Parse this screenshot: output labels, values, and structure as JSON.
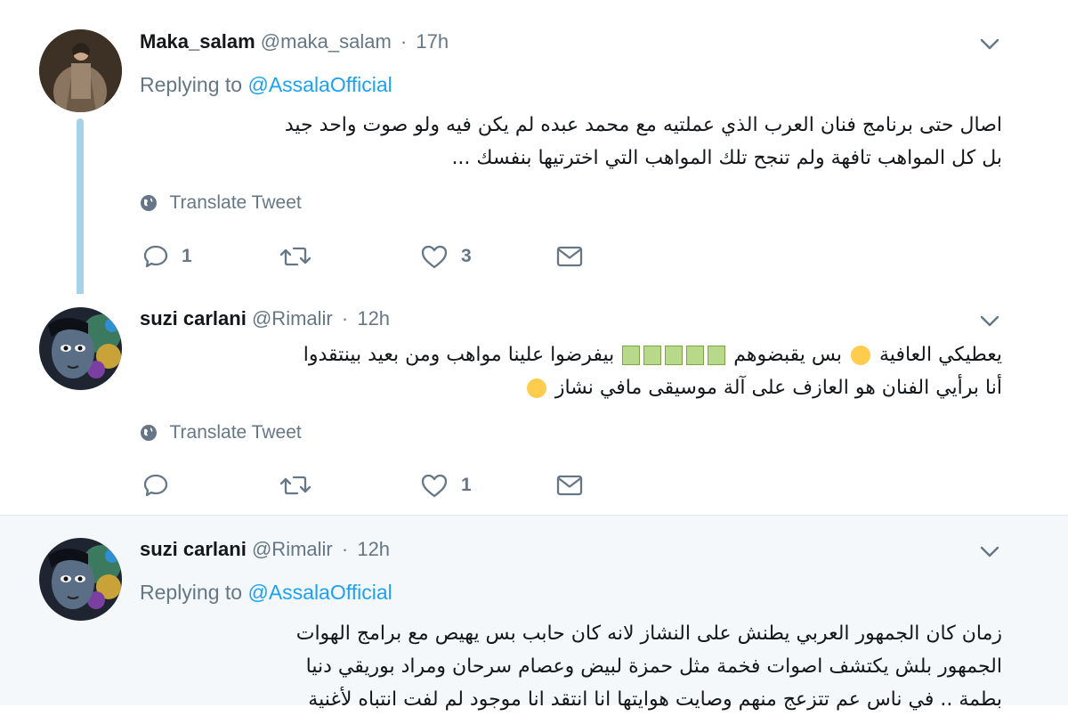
{
  "tweets": [
    {
      "name": "Maka_salam",
      "handle": "@maka_salam",
      "separator": "·",
      "time": "17h",
      "replying_prefix": "Replying to",
      "replying_to": "@AssalaOfficial",
      "text_lines": [
        "اصال حتى برنامج فنان العرب الذي عملتيه مع محمد عبده لم يكن فيه ولو صوت واحد جيد",
        "بل كل المواهب تافهة ولم تنجح تلك المواهب التي اخترتيها بنفسك ..."
      ],
      "translate_label": "Translate Tweet",
      "reply_count": "1",
      "retweet_count": "",
      "like_count": "3"
    },
    {
      "name": "suzi carlani",
      "handle": "@Rimalir",
      "separator": "·",
      "time": "12h",
      "text_line1_a": "يعطيكي العافية",
      "text_line1_b": "بس يقبضوهم",
      "text_line1_c": "بيفرضوا علينا مواهب ومن بعيد بينتقدوا",
      "text_line2": "أنا برأيي الفنان هو العازف على آلة موسيقى مافي نشاز",
      "translate_label": "Translate Tweet",
      "reply_count": "",
      "retweet_count": "",
      "like_count": "1"
    },
    {
      "name": "suzi carlani",
      "handle": "@Rimalir",
      "separator": "·",
      "time": "12h",
      "replying_prefix": "Replying to",
      "replying_to": "@AssalaOfficial",
      "text_lines": [
        "زمان كان الجمهور العربي يطنش على النشاز لانه كان حابب بس يهيص مع برامج الهوات",
        "الجمهور بلش يكتشف اصوات فخمة مثل حمزة لبيض وعصام سرحان ومراد بوريقي دنيا",
        "بطمة .. في ناس عم تتزعج منهم وصايت هوايتها انا انتقد انا موجود لم لفت انتباه لأغنية"
      ]
    }
  ],
  "colors": {
    "link": "#1da1f2",
    "secondary_text": "#657786",
    "thread_line": "#a5d2e6",
    "highlight_bg": "#f5f8fa"
  },
  "icons": [
    "chevron-down-icon",
    "globe-icon",
    "reply-icon",
    "retweet-icon",
    "like-icon",
    "message-icon"
  ]
}
